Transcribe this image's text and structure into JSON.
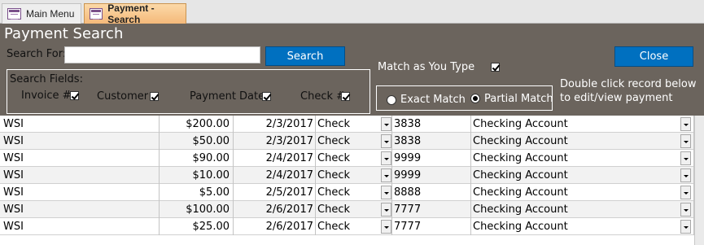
{
  "tabs": {
    "main_menu": "Main Menu",
    "payment_search": "Payment - Search"
  },
  "form": {
    "title": "Payment Search",
    "search_for_label": "Search For:",
    "search_input_value": "",
    "search_button": "Search",
    "close_button": "Close",
    "match_as_you_type_label": "Match as You Type",
    "match_as_you_type_checked": true,
    "search_fields_label": "Search Fields:",
    "fields": {
      "invoice": {
        "label": "Invoice #",
        "checked": true
      },
      "customer": {
        "label": "Customer",
        "checked": true
      },
      "payment_date": {
        "label": "Payment Date",
        "checked": true
      },
      "check": {
        "label": "Check #",
        "checked": true
      }
    },
    "match_mode": {
      "exact_label": "Exact Match",
      "partial_label": "Partial Match",
      "selected": "partial"
    },
    "hint": "Double click record below to edit/view payment"
  },
  "rows": [
    {
      "customer": "WSI",
      "amount": "$200.00",
      "date": "2/3/2017",
      "type": "Check",
      "check_no": "3838",
      "account": "Checking Account"
    },
    {
      "customer": "WSI",
      "amount": "$50.00",
      "date": "2/3/2017",
      "type": "Check",
      "check_no": "3838",
      "account": "Checking Account"
    },
    {
      "customer": "WSI",
      "amount": "$90.00",
      "date": "2/4/2017",
      "type": "Check",
      "check_no": "9999",
      "account": "Checking Account"
    },
    {
      "customer": "WSI",
      "amount": "$10.00",
      "date": "2/4/2017",
      "type": "Check",
      "check_no": "9999",
      "account": "Checking Account"
    },
    {
      "customer": "WSI",
      "amount": "$5.00",
      "date": "2/5/2017",
      "type": "Check",
      "check_no": "8888",
      "account": "Checking Account"
    },
    {
      "customer": "WSI",
      "amount": "$100.00",
      "date": "2/6/2017",
      "type": "Check",
      "check_no": "7777",
      "account": "Checking Account"
    },
    {
      "customer": "WSI",
      "amount": "$25.00",
      "date": "2/6/2017",
      "type": "Check",
      "check_no": "7777",
      "account": "Checking Account"
    }
  ],
  "colors": {
    "header_bg": "#6b645d",
    "button_blue": "#0070c0",
    "active_tab": "#f4b97a"
  }
}
